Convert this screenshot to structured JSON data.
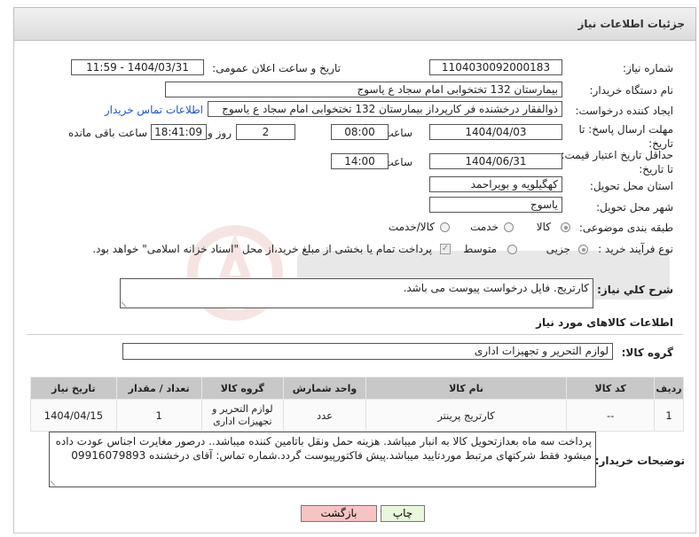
{
  "header": {
    "title": "جزئیات اطلاعات نیاز"
  },
  "fields": {
    "need_number_label": "شماره نیاز:",
    "need_number": "1104030092000183",
    "announce_label": "تاریخ و ساعت اعلان عمومی:",
    "announce_value": "1404/03/31 - 11:59",
    "buyer_label": "نام دستگاه خریدار:",
    "buyer_value": "بیمارستان 132 تختخوابی امام سجاد  ع  یاسوج",
    "creator_label": "ایجاد کننده درخواست:",
    "creator_value": "ذوالفقار درخشنده فر کارپرداز بیمارستان 132 تختخوابی امام سجاد  ع  یاسوج",
    "contact_link": "اطلاعات تماس خریدار",
    "reply_deadline_label": "مهلت ارسال پاسخ: تا تاریخ:",
    "reply_date": "1404/04/03",
    "time_label": "ساعت",
    "reply_time": "08:00",
    "days_value": "2",
    "days_label": "روز و",
    "remaining_time": "18:41:09",
    "remaining_label": "ساعت باقی مانده",
    "validity_label": "حداقل تاریخ اعتبار قیمت: تا تاریخ:",
    "validity_date": "1404/06/31",
    "validity_time_label": "ساعت",
    "validity_time": "14:00",
    "province_label": "استان محل تحویل:",
    "province_value": "کهگیلویه و بویراحمد",
    "city_label": "شهر محل تحویل:",
    "city_value": "یاسوج",
    "category_label": "طبقه بندی موضوعی:",
    "category_options": [
      "کالا",
      "خدمت",
      "کالا/خدمت"
    ],
    "process_label": "نوع فرآیند خرید :",
    "process_options": [
      "جزیی",
      "متوسط"
    ],
    "payment_note": "پرداخت تمام یا بخشی از مبلغ خرید،از محل \"اسناد خزانه اسلامی\" خواهد بود."
  },
  "description": {
    "label": "شرح كلي نیاز:",
    "value": "کارتریج.  فایل درخواست پیوست می باشد."
  },
  "goods": {
    "section_title": "اطلاعات کالاهای مورد نیاز",
    "group_label": "گروه کالا:",
    "group_value": "لوازم التحریر و تجهیزات اداری",
    "columns": [
      "ردیف",
      "کد کالا",
      "نام کالا",
      "واحد شمارش",
      "گروه کالا",
      "تعداد / مقدار",
      "تاریخ نیاز"
    ],
    "rows": [
      {
        "index": "1",
        "code": "--",
        "name": "کارتریج پرینتر",
        "unit": "عدد",
        "group": "لوازم التحریر و تجهیزات اداری",
        "qty": "1",
        "date": "1404/04/15"
      }
    ]
  },
  "buyer_notes": {
    "label": "توضیحات خریدار:",
    "value": "پرداخت سه ماه بعدازتحویل کالا به انبار میباشد. هزینه حمل ونقل باتامین کننده میباشد.. درصور مغایرت اجناس عودت داده میشود فقط شرکتهای مرتبط موردتایید میباشد.پیش فاکتورپیوست گردد.شماره تماس: آقای درخشنده 09916079893"
  },
  "buttons": {
    "print": "چاپ",
    "back": "بازگشت"
  },
  "colors": {
    "link": "#1a55c0",
    "back_button_bg": "#f7c4c4",
    "print_button_bg": "#e9f7dc",
    "table_header_bg": "#c8c8c8"
  }
}
